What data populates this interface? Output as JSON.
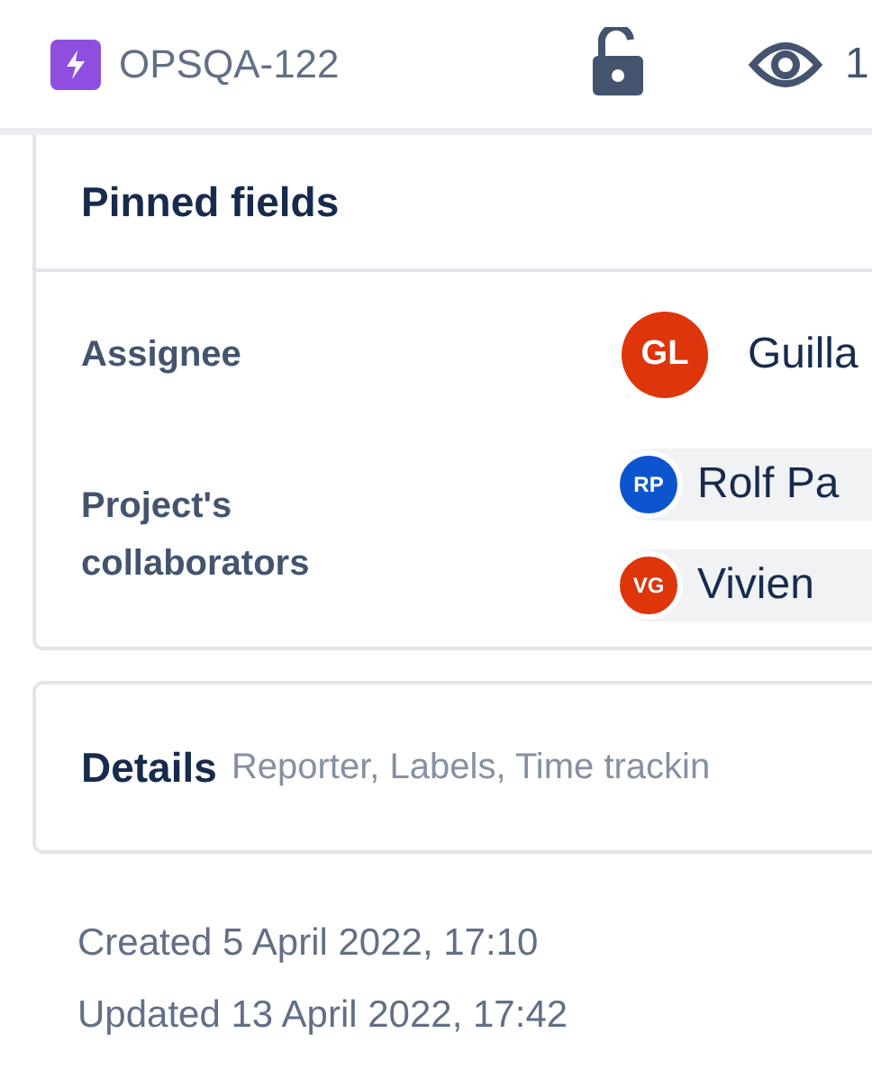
{
  "header": {
    "issue_key": "OPSQA-122",
    "watchers": "1"
  },
  "pinned": {
    "title": "Pinned fields",
    "fields": [
      {
        "label": "Assignee",
        "kind": "single",
        "users": [
          {
            "initials": "GL",
            "name": "Guilla",
            "color": "#de350b"
          }
        ]
      },
      {
        "label": "Project's collaborators",
        "kind": "multi",
        "users": [
          {
            "initials": "RP",
            "name": "Rolf Pa",
            "color": "#0c55cf"
          },
          {
            "initials": "VG",
            "name": "Vivien",
            "color": "#de350b"
          }
        ]
      }
    ]
  },
  "details": {
    "title": "Details",
    "summary": "Reporter, Labels, Time trackin"
  },
  "dates": [
    "Created 5 April 2022, 17:10",
    "Updated 13 April 2022, 17:42"
  ]
}
